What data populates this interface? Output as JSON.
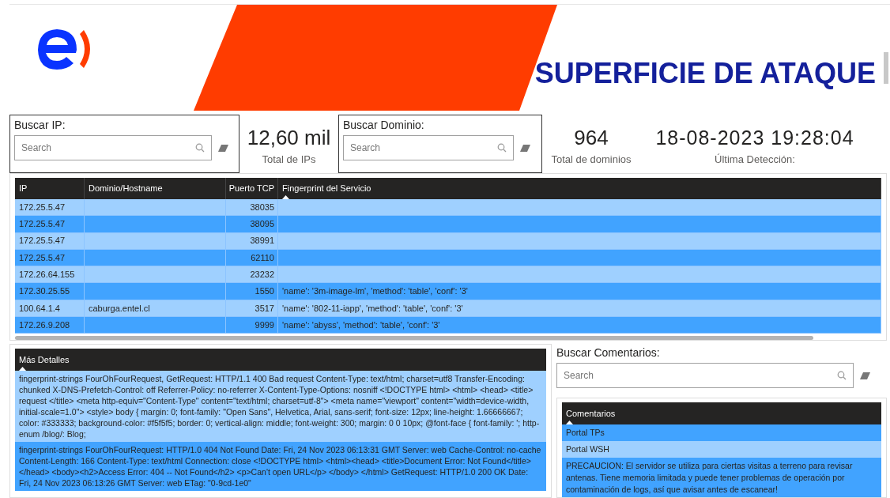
{
  "header": {
    "title": "SUPERFICIE DE ATAQUE"
  },
  "ip_search": {
    "label": "Buscar IP:",
    "placeholder": "Search"
  },
  "total_ips": {
    "value": "12,60 mil",
    "label": "Total de IPs"
  },
  "domain_search": {
    "label": "Buscar Dominio:",
    "placeholder": "Search"
  },
  "total_domains": {
    "value": "964",
    "label": "Total de dominios"
  },
  "last_detection": {
    "value": "18-08-2023 19:28:04",
    "label": "Última Detección:"
  },
  "table": {
    "columns": [
      {
        "label": "IP",
        "sorted": false
      },
      {
        "label": "Dominio/Hostname",
        "sorted": false
      },
      {
        "label": "Puerto TCP",
        "sorted": false
      },
      {
        "label": "Fingerprint del Servicio",
        "sorted": true
      }
    ],
    "rows": [
      [
        "172.25.5.47",
        "",
        "38035",
        ""
      ],
      [
        "172.25.5.47",
        "",
        "38095",
        ""
      ],
      [
        "172.25.5.47",
        "",
        "38991",
        ""
      ],
      [
        "172.25.5.47",
        "",
        "62110",
        ""
      ],
      [
        "172.26.64.155",
        "",
        "23232",
        ""
      ],
      [
        "172.30.25.55",
        "",
        "1550",
        "'name': '3m-image-lm', 'method': 'table', 'conf': '3'"
      ],
      [
        "100.64.1.4",
        "caburga.entel.cl",
        "3517",
        "'name': '802-11-iapp', 'method': 'table', 'conf': '3'"
      ],
      [
        "172.26.9.208",
        "",
        "9999",
        "'name': 'abyss', 'method': 'table', 'conf': '3'"
      ]
    ]
  },
  "details": {
    "column": {
      "label": "Más Detalles",
      "sorted": true
    },
    "rows": [
      "fingerprint-strings FourOhFourRequest, GetRequest: HTTP/1.1 400 Bad request Content-Type: text/html; charset=utf8 Transfer-Encoding: chunked X-DNS-Prefetch-Control: off Referrer-Policy: no-referrer X-Content-Type-Options: nosniff <!DOCTYPE html> <html> <head> <title> request </title> <meta http-equiv=\"Content-Type\" content=\"text/html; charset=utf-8\"> <meta name=\"viewport\" content=\"width=device-width, initial-scale=1.0\"> <style> body { margin: 0; font-family: \"Open Sans\", Helvetica, Arial, sans-serif; font-size: 12px; line-height: 1.66666667; color: #333333; background-color: #f5f5f5; border: 0; vertical-align: middle; font-weight: 300; margin: 0 0 10px; @font-face { font-family: '; http-enum /blog/: Blog;",
      "fingerprint-strings FourOhFourRequest: HTTP/1.0 404 Not Found Date: Fri, 24 Nov 2023 06:13:31 GMT Server: web Cache-Control: no-cache Content-Length: 166 Content-Type: text/html Connection: close <!DOCTYPE html> <html><head> <title>Document Error: Not Found</title></head> <body><h2>Access Error: 404 -- Not Found</h2> <p>Can't open URL</p> </body> </html> GetRequest: HTTP/1.0 200 OK Date: Fri, 24 Nov 2023 06:13:26 GMT Server: web ETag: \"0-9cd-1e0\""
    ]
  },
  "comment_search": {
    "label": "Buscar Comentarios:",
    "placeholder": "Search"
  },
  "comments": {
    "column": {
      "label": "Comentarios",
      "sorted": true
    },
    "rows": [
      "Portal TPs",
      "Portal WSH",
      "PRECAUCION: El servidor se utiliza para ciertas visitas a terreno para revisar antenas. Tiene memoria limitada y puede tener problemas de operación por contaminación de logs, así que avisar antes de escanear!"
    ]
  }
}
